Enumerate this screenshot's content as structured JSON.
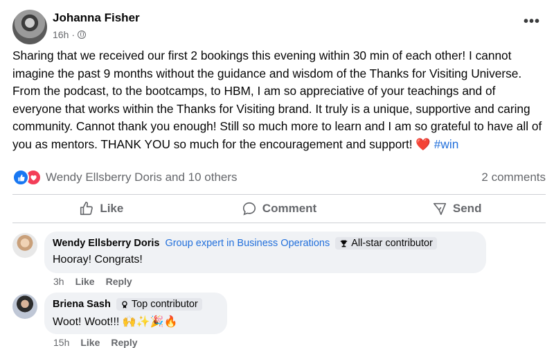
{
  "post": {
    "author": "Johanna Fisher",
    "time": "16h",
    "separator": "·",
    "more_label": "•••",
    "body": "Sharing that we received our first 2 bookings this evening within 30 min of each other! I cannot imagine the past 9 months without the guidance and wisdom of the Thanks for Visiting Universe. From the podcast, to the bootcamps, to HBM, I am so appreciative of your teachings and of everyone that works within the Thanks for Visiting brand. It truly is a unique, supportive and caring community. Cannot thank you enough! Still so much more to learn and I am so grateful to have all of you as mentors. THANK YOU so much for the encouragement and support! ",
    "heart": "❤️",
    "hashtag": "#win"
  },
  "reactions": {
    "icons": [
      "like-icon",
      "love-icon"
    ],
    "names": "Wendy Ellsberry Doris and 10 others",
    "comments_count": "2 comments"
  },
  "actions": {
    "like": "Like",
    "comment": "Comment",
    "send": "Send"
  },
  "comments": [
    {
      "name": "Wendy Ellsberry Doris",
      "role": "Group expert in Business Operations",
      "badge": "All-star contributor",
      "badge_icon": "trophy-icon",
      "text": "Hooray! Congrats!",
      "time": "3h",
      "like": "Like",
      "reply": "Reply"
    },
    {
      "name": "Briena Sash",
      "badge": "Top contributor",
      "badge_icon": "ribbon-icon",
      "text": "Woot! Woot!!! 🙌✨🎉🔥",
      "time": "15h",
      "like": "Like",
      "reply": "Reply"
    }
  ],
  "colors": {
    "accent": "#216fdb",
    "like_blue": "#1877f2",
    "love_red": "#f33e58",
    "muted": "#65676b"
  }
}
